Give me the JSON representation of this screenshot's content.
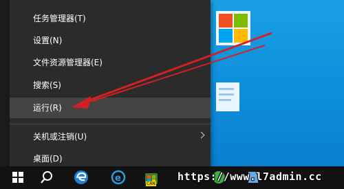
{
  "menu": {
    "items": [
      {
        "label": "任务管理器(T)"
      },
      {
        "label": "设置(N)"
      },
      {
        "label": "文件资源管理器(E)"
      },
      {
        "label": "搜索(S)"
      },
      {
        "label": "运行(R)"
      },
      {
        "label": "关机或注销(U)"
      },
      {
        "label": "桌面(D)"
      }
    ]
  },
  "taskbar": {
    "search_icon": "search-icon",
    "edge_icon": "edge-icon",
    "ie_icon": "ie-icon",
    "store_icon": "store-icon",
    "game_badge": "CAN"
  },
  "watermark": {
    "text": "https://www.l7admin.cc"
  },
  "colors": {
    "menu_bg": "#2b2b2b",
    "highlight": "#444444",
    "annotation_arrow": "#d42020",
    "desktop": "#1a9fe3"
  }
}
